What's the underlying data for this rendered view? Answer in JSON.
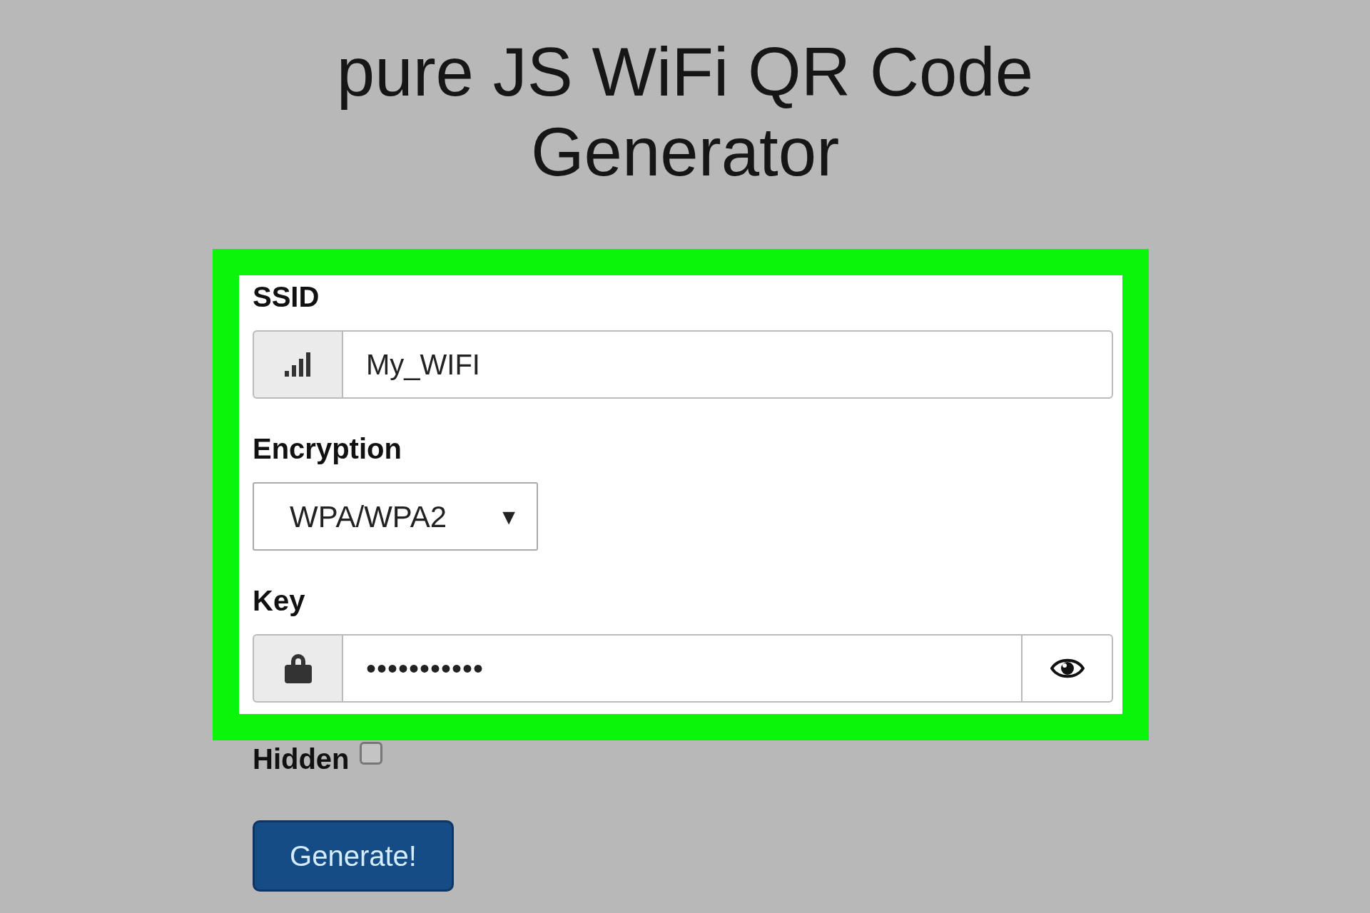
{
  "title": "pure JS WiFi QR Code Generator",
  "fields": [
    {
      "kind": "text",
      "label": "SSID",
      "value": "My_WIFI"
    },
    {
      "kind": "select",
      "label": "Encryption",
      "value": "WPA/WPA2",
      "arrow": "▼"
    },
    {
      "kind": "password",
      "label": "Key",
      "value": "•••••••••••"
    }
  ],
  "hidden": {
    "label": "Hidden",
    "checked": false
  },
  "button": "Generate!"
}
